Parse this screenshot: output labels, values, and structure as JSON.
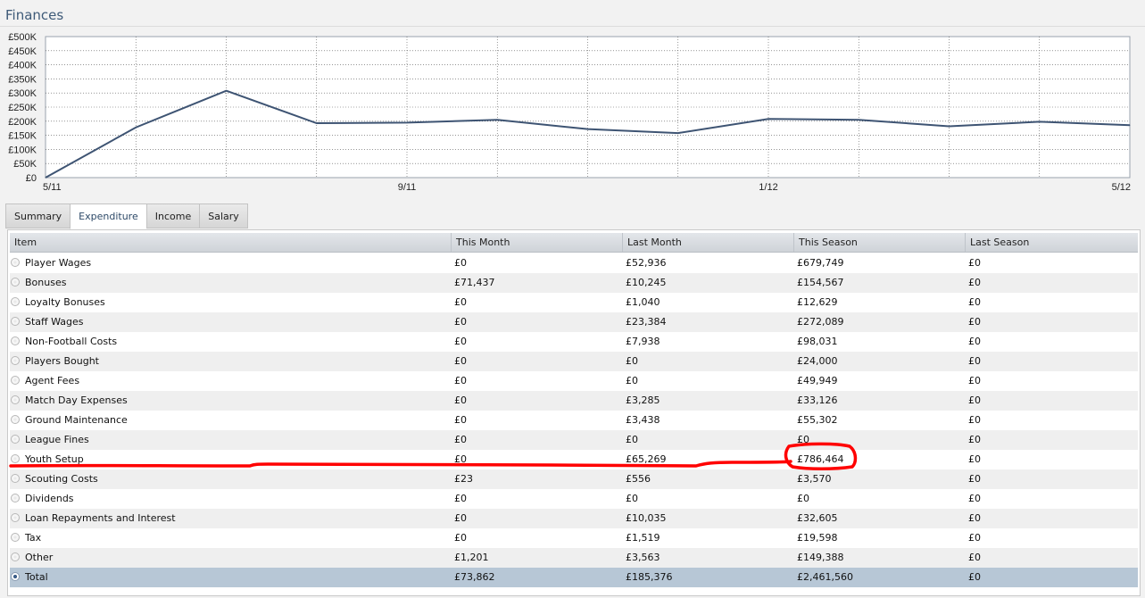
{
  "page": {
    "title": "Finances"
  },
  "chart_data": {
    "type": "line",
    "x": [
      "5/11",
      "",
      "",
      "",
      "9/11",
      "",
      "",
      "",
      "1/12",
      "",
      "",
      "",
      "5/12"
    ],
    "series": [
      {
        "values": [
          0,
          178000,
          308000,
          193000,
          195000,
          205000,
          172000,
          158000,
          208000,
          205000,
          182000,
          198000,
          186000
        ]
      }
    ],
    "ylim": [
      0,
      500000
    ],
    "yticks": [
      "£0",
      "£50K",
      "£100K",
      "£150K",
      "£200K",
      "£250K",
      "£300K",
      "£350K",
      "£400K",
      "£450K",
      "£500K"
    ],
    "xtick_labels": [
      "5/11",
      "9/11",
      "1/12",
      "5/12"
    ],
    "grid": true,
    "line_color": "#3e5473"
  },
  "tabs": [
    {
      "label": "Summary",
      "active": false
    },
    {
      "label": "Expenditure",
      "active": true
    },
    {
      "label": "Income",
      "active": false
    },
    {
      "label": "Salary",
      "active": false
    }
  ],
  "table": {
    "columns": [
      "Item",
      "This Month",
      "Last Month",
      "This Season",
      "Last Season"
    ],
    "rows": [
      [
        "Player Wages",
        "£0",
        "£52,936",
        "£679,749",
        "£0"
      ],
      [
        "Bonuses",
        "£71,437",
        "£10,245",
        "£154,567",
        "£0"
      ],
      [
        "Loyalty Bonuses",
        "£0",
        "£1,040",
        "£12,629",
        "£0"
      ],
      [
        "Staff Wages",
        "£0",
        "£23,384",
        "£272,089",
        "£0"
      ],
      [
        "Non-Football Costs",
        "£0",
        "£7,938",
        "£98,031",
        "£0"
      ],
      [
        "Players Bought",
        "£0",
        "£0",
        "£24,000",
        "£0"
      ],
      [
        "Agent Fees",
        "£0",
        "£0",
        "£49,949",
        "£0"
      ],
      [
        "Match Day Expenses",
        "£0",
        "£3,285",
        "£33,126",
        "£0"
      ],
      [
        "Ground Maintenance",
        "£0",
        "£3,438",
        "£55,302",
        "£0"
      ],
      [
        "League Fines",
        "£0",
        "£0",
        "£0",
        "£0"
      ],
      [
        "Youth Setup",
        "£0",
        "£65,269",
        "£786,464",
        "£0"
      ],
      [
        "Scouting Costs",
        "£23",
        "£556",
        "£3,570",
        "£0"
      ],
      [
        "Dividends",
        "£0",
        "£0",
        "£0",
        "£0"
      ],
      [
        "Loan Repayments and Interest",
        "£0",
        "£10,035",
        "£32,605",
        "£0"
      ],
      [
        "Tax",
        "£0",
        "£1,519",
        "£19,598",
        "£0"
      ],
      [
        "Other",
        "£1,201",
        "£3,563",
        "£149,388",
        "£0"
      ],
      [
        "Total",
        "£73,862",
        "£185,376",
        "£2,461,560",
        "£0"
      ]
    ]
  },
  "annotation": {
    "color": "#ff0000"
  }
}
